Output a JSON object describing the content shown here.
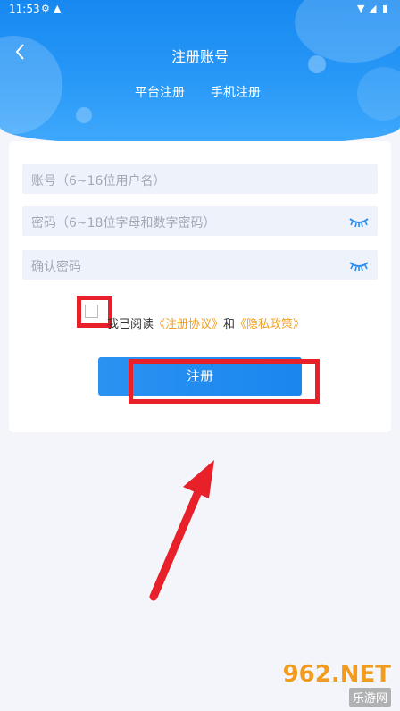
{
  "status_bar": {
    "time": "11:53"
  },
  "header": {
    "title": "注册账号",
    "tabs": [
      {
        "label": "平台注册"
      },
      {
        "label": "手机注册"
      }
    ]
  },
  "form": {
    "account_placeholder": "账号（6~16位用户名）",
    "password_placeholder": "密码（6~18位字母和数字密码）",
    "confirm_placeholder": "确认密码"
  },
  "agreement": {
    "prefix": "我已阅读",
    "terms_link": "《注册协议》",
    "and": "和",
    "privacy_link": "《隐私政策》"
  },
  "register_button": {
    "label": "注册"
  },
  "watermark": {
    "brand": "962.NET",
    "sub": "乐游网"
  },
  "colors": {
    "header_blue": "#1688f0",
    "link_orange": "#f0a020",
    "annotation_red": "#e8202a"
  }
}
